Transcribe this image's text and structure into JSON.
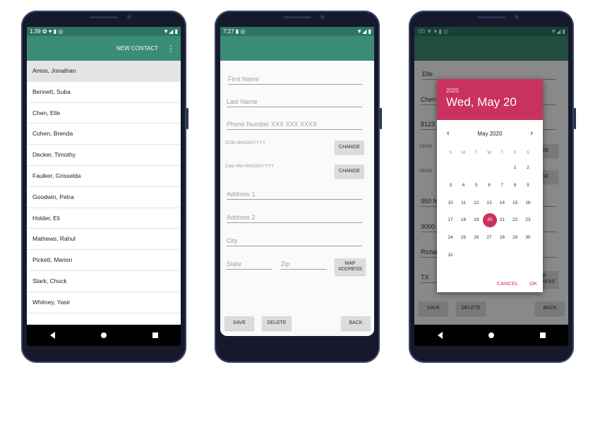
{
  "phone1": {
    "status": {
      "time": "1:39",
      "icons": "✿ ♥ ▮ ◎",
      "right": "▼◢ ▮"
    },
    "appbar": {
      "action": "NEW CONTACT",
      "menu": "⋮"
    },
    "contacts": [
      "Amos, Jonathan",
      "Bennett, Suba",
      "Chen, Elle",
      "Cohen, Brenda",
      "Decker, Timothy",
      "Faulker, Grisselda",
      "Goodwin, Petra",
      "Holder, Eli",
      "Mathews, Rahul",
      "Pickett, Marion",
      "Stark, Chuck",
      "Whitney, Yasir"
    ]
  },
  "phone2": {
    "status": {
      "time": "7:27",
      "icons": "▮ ◎",
      "right": "▼◢ ▮"
    },
    "form": {
      "first_name": "First Name",
      "last_name": "Last Name",
      "phone": "Phone Number XXX XXX XXXX",
      "dob": "DOB MM/DD/YYYY",
      "date_met": "Date Met MM/DD/YYYY",
      "change": "CHANGE",
      "address1": "Address 1",
      "address2": "Address 2",
      "city": "City",
      "state": "State",
      "zip": "Zip",
      "map_address": "MAP ADDRESS",
      "save": "SAVE",
      "delete": "DELETE",
      "back": "BACK"
    }
  },
  "phone3": {
    "status": {
      "time": ":00",
      "icons": "▼ ♥ ▮ ◎",
      "right": "▼◢ ▮"
    },
    "behind": {
      "first": "Elle",
      "last": "Chen",
      "phone": "8123",
      "dob": "03/04/",
      "met": "05/20/",
      "change": "NGE",
      "change2": "NGE",
      "address": "950 N",
      "address2": "3000",
      "city": "Richa",
      "state": "TX",
      "map": "AP ADDRESS",
      "save": "SAVE",
      "delete": "DELETE",
      "back": "BACK"
    },
    "picker": {
      "year": "2020",
      "date": "Wed, May 20",
      "month": "May 2020",
      "prev": "‹",
      "next": "›",
      "weekdays": [
        "S",
        "M",
        "T",
        "W",
        "T",
        "F",
        "S"
      ],
      "days": [
        "",
        "",
        "",
        "",
        "",
        "1",
        "2",
        "3",
        "4",
        "5",
        "6",
        "7",
        "8",
        "9",
        "10",
        "11",
        "12",
        "13",
        "14",
        "15",
        "16",
        "17",
        "18",
        "19",
        "20",
        "21",
        "22",
        "23",
        "24",
        "25",
        "26",
        "27",
        "28",
        "29",
        "30",
        "31"
      ],
      "selected": "20",
      "cancel": "CANCEL",
      "ok": "OK"
    }
  }
}
